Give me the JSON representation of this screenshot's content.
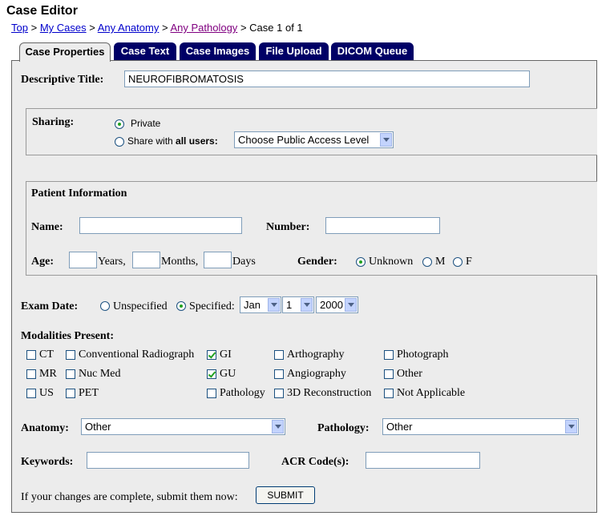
{
  "page_title": "Case Editor",
  "breadcrumb": {
    "items": [
      {
        "label": "Top"
      },
      {
        "label": "My Cases"
      },
      {
        "label": "Any Anatomy"
      },
      {
        "label": "Any Pathology"
      }
    ],
    "separator": ">",
    "current": "Case 1 of 1"
  },
  "tabs": [
    {
      "label": "Case Properties",
      "active": true
    },
    {
      "label": "Case Text"
    },
    {
      "label": "Case Images"
    },
    {
      "label": "File Upload"
    },
    {
      "label": "DICOM Queue"
    }
  ],
  "descriptive_title": {
    "label": "Descriptive Title:",
    "value": "NEUROFIBROMATOSIS"
  },
  "sharing": {
    "label": "Sharing:",
    "private_label": "Private",
    "share_label_prefix": "Share with ",
    "share_label_bold": "all users:",
    "access_select": "Choose Public Access Level",
    "selected": "private"
  },
  "patient": {
    "heading": "Patient Information",
    "name_label": "Name:",
    "name_value": "",
    "number_label": "Number:",
    "number_value": "",
    "age_label": "Age:",
    "years_label": "Years,",
    "months_label": "Months,",
    "days_label": "Days",
    "gender_label": "Gender:",
    "gender_options": [
      "Unknown",
      "M",
      "F"
    ],
    "gender_selected": "Unknown"
  },
  "exam_date": {
    "label": "Exam Date:",
    "unspecified_label": "Unspecified",
    "specified_label": "Specified:",
    "selected": "specified",
    "month": "Jan",
    "day": "1",
    "year": "2000"
  },
  "modalities": {
    "label": "Modalities Present:",
    "items": [
      {
        "label": "CT",
        "checked": false
      },
      {
        "label": "Conventional Radiograph",
        "checked": false
      },
      {
        "label": "GI",
        "checked": true
      },
      {
        "label": "Arthography",
        "checked": false
      },
      {
        "label": "Photograph",
        "checked": false
      },
      {
        "label": "MR",
        "checked": false
      },
      {
        "label": "Nuc Med",
        "checked": false
      },
      {
        "label": "GU",
        "checked": true
      },
      {
        "label": "Angiography",
        "checked": false
      },
      {
        "label": "Other",
        "checked": false
      },
      {
        "label": "US",
        "checked": false
      },
      {
        "label": "PET",
        "checked": false
      },
      {
        "label": "Pathology",
        "checked": false
      },
      {
        "label": "3D Reconstruction",
        "checked": false
      },
      {
        "label": "Not Applicable",
        "checked": false
      }
    ]
  },
  "anatomy": {
    "label": "Anatomy:",
    "value": "Other"
  },
  "pathology": {
    "label": "Pathology:",
    "value": "Other"
  },
  "keywords": {
    "label": "Keywords:",
    "value": ""
  },
  "acr": {
    "label": "ACR Code(s):",
    "value": ""
  },
  "submit": {
    "prompt": "If your changes are complete, submit them now:",
    "button": "SUBMIT"
  }
}
